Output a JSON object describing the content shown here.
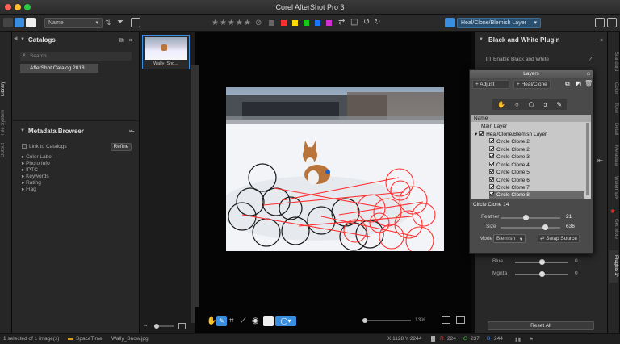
{
  "window": {
    "title": "Corel AfterShot Pro 3"
  },
  "toolbar": {
    "sort_dropdown": "Name",
    "stars_label": "★★★★★",
    "tool_dropdown": "Heal/Clone/Blemish Layer",
    "color_labels": [
      "#ff3030",
      "#ffdc00",
      "#18c818",
      "#1e78ff",
      "#d030d0"
    ]
  },
  "left_tabs": [
    "Library",
    "File System",
    "Output"
  ],
  "catalogs": {
    "title": "Catalogs",
    "search_placeholder": "Search",
    "items": [
      "AfterShot Catalog 2018"
    ]
  },
  "metadata_browser": {
    "title": "Metadata Browser",
    "link_label": "Link to Catalogs",
    "refine_label": "Refine",
    "items": [
      "Color Label",
      "Photo Info",
      "IPTC",
      "Keywords",
      "Rating",
      "Flag"
    ]
  },
  "thumbnail": {
    "label": "Wally_Sno..."
  },
  "viewer": {
    "zoom": "13%"
  },
  "right_panel": {
    "title": "Black and White Plugin",
    "enable_label": "Enable Black and White",
    "help": "?",
    "sliders": [
      {
        "label": "Blue",
        "value": "0",
        "pos": 0.5
      },
      {
        "label": "Mgnta",
        "value": "0",
        "pos": 0.5
      }
    ],
    "reset_label": "Reset All"
  },
  "right_tabs": [
    "Standard",
    "Color",
    "Tone",
    "Detail",
    "Metadata",
    "Watermark",
    "Get More",
    "Plugins 1*"
  ],
  "layers": {
    "title": "Layers",
    "adjust_label": "Adjust",
    "heal_label": "Heal/Clone",
    "col_name": "Name",
    "main_layer": "Main Layer",
    "group": "Heal/Clone/Blemish Layer",
    "rows": [
      "Circle Clone 2",
      "Circle Clone 2",
      "Circle Clone 3",
      "Circle Clone 4",
      "Circle Clone 5",
      "Circle Clone 6",
      "Circle Clone 7",
      "Circle Clone 8"
    ],
    "selected_row": 7,
    "detail_title": "Circle Clone 14",
    "feather_label": "Feather",
    "feather_value": "21",
    "feather_pos": 0.43,
    "size_label": "Size",
    "size_value": "636",
    "size_pos": 0.75,
    "mode_label": "Mode",
    "mode_value": "Blemish",
    "swap_label": "Swap Source"
  },
  "status": {
    "selected": "1 selected of 1 image(s)",
    "folder": "SpaceTime",
    "file": "Wally_Snow.jpg",
    "coords": "X 1128  Y 2244",
    "r_label": "R",
    "r_value": "224",
    "g_label": "G",
    "g_value": "237",
    "b_label": "B",
    "b_value": "244"
  }
}
